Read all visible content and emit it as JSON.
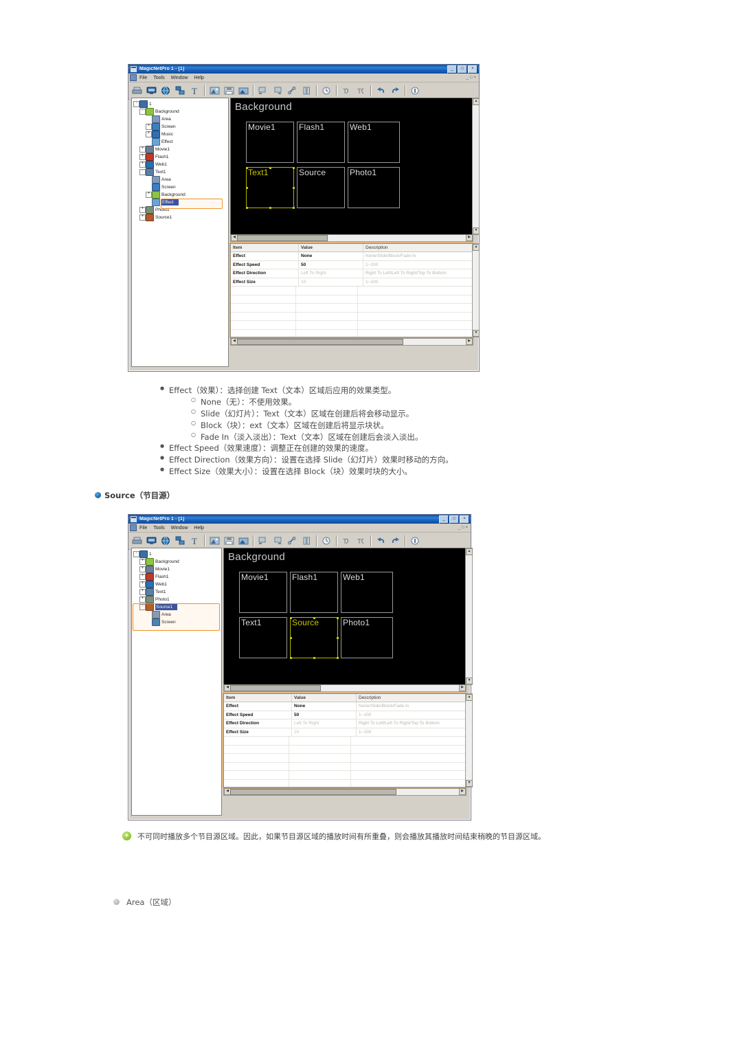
{
  "window": {
    "title": "MagicNetPro 1 - [1]",
    "menu": [
      "File",
      "Tools",
      "Window",
      "Help"
    ],
    "controls": [
      "_",
      "□",
      "×"
    ],
    "mdi_controls": [
      "_",
      "□",
      "×"
    ],
    "toolbar_icons": [
      "print-icon",
      "monitor-icon",
      "globe-icon",
      "network-icon",
      "text-tool-icon",
      "image-icon",
      "save-icon",
      "photo-icon",
      "align-left-icon",
      "align-right-icon",
      "link-icon",
      "column-icon",
      "clock-icon",
      "effect-in-icon",
      "effect-out-icon",
      "undo-icon",
      "redo-icon",
      "info-icon"
    ]
  },
  "figure1": {
    "tree": [
      {
        "label": "1",
        "depth": 0,
        "icon": "root-icon",
        "expander": "-",
        "selected": false
      },
      {
        "label": "Background",
        "depth": 1,
        "icon": "background-icon",
        "expander": "-",
        "selected": false
      },
      {
        "label": "Area",
        "depth": 2,
        "icon": "area-icon",
        "expander": "",
        "selected": false
      },
      {
        "label": "Screen",
        "depth": 2,
        "icon": "screen-icon",
        "expander": "+",
        "selected": false
      },
      {
        "label": "Music",
        "depth": 2,
        "icon": "music-icon",
        "expander": "+",
        "selected": false
      },
      {
        "label": "Effect",
        "depth": 2,
        "icon": "effect-icon",
        "expander": "",
        "selected": false
      },
      {
        "label": "Movie1",
        "depth": 1,
        "icon": "movie-icon",
        "expander": "+",
        "selected": false
      },
      {
        "label": "Flash1",
        "depth": 1,
        "icon": "flash-icon",
        "expander": "+",
        "selected": false
      },
      {
        "label": "Web1",
        "depth": 1,
        "icon": "web-icon",
        "expander": "+",
        "selected": false
      },
      {
        "label": "Text1",
        "depth": 1,
        "icon": "text-icon",
        "expander": "-",
        "selected": false
      },
      {
        "label": "Area",
        "depth": 2,
        "icon": "area-icon",
        "expander": "",
        "selected": false
      },
      {
        "label": "Screen",
        "depth": 2,
        "icon": "screen-icon",
        "expander": "",
        "selected": false
      },
      {
        "label": "Background",
        "depth": 2,
        "icon": "background-icon",
        "expander": "+",
        "selected": false
      },
      {
        "label": "Effect",
        "depth": 2,
        "icon": "effect-icon",
        "expander": "",
        "selected": true
      },
      {
        "label": "Photo1",
        "depth": 1,
        "icon": "photo-icon",
        "expander": "+",
        "selected": false
      },
      {
        "label": "Source1",
        "depth": 1,
        "icon": "source-icon",
        "expander": "+",
        "selected": false
      }
    ],
    "canvas": {
      "title": "Background",
      "boxes": [
        {
          "label": "Movie1",
          "selected": false
        },
        {
          "label": "Flash1",
          "selected": false
        },
        {
          "label": "Web1",
          "selected": false
        },
        {
          "label": "Text1",
          "selected": true
        },
        {
          "label": "Source",
          "selected": false
        },
        {
          "label": "Photo1",
          "selected": false
        }
      ]
    },
    "props": {
      "headers": [
        "Item",
        "Value",
        "Description"
      ],
      "rows": [
        {
          "item": "Effect",
          "value": "None",
          "desc": "None/Slide/Block/Fade In",
          "dim": false
        },
        {
          "item": "Effect Speed",
          "value": "50",
          "desc": "1~100",
          "dim": false
        },
        {
          "item": "Effect Direction",
          "value": "Left To Right",
          "desc": "Right To Left/Left To Right/Top To Bottom",
          "dim": true
        },
        {
          "item": "Effect Size",
          "value": "10",
          "desc": "1~100",
          "dim": true
        }
      ]
    }
  },
  "effect_list": {
    "b1": "Effect（效果）：选择创建 Text（文本）区域后应用的效果类型。",
    "s1": "None（无）：不使用效果。",
    "s2": "Slide（幻灯片）：Text（文本）区域在创建后将会移动显示。",
    "s3": "Block（块）：ext（文本）区域在创建后将显示块状。",
    "s4": "Fade In（淡入淡出）：Text（文本）区域在创建后会淡入淡出。",
    "b2": "Effect Speed（效果速度）：调整正在创建的效果的速度。",
    "b3": "Effect Direction（效果方向）：设置在选择 Slide（幻灯片）效果时移动的方向。",
    "b4": "Effect Size（效果大小）：设置在选择 Block（块）效果时块的大小。"
  },
  "source_section": {
    "heading": "Source（节目源）"
  },
  "figure2": {
    "tree": [
      {
        "label": "1",
        "depth": 0,
        "icon": "root-icon",
        "expander": "-",
        "selected": false
      },
      {
        "label": "Background",
        "depth": 1,
        "icon": "background-icon",
        "expander": "+",
        "selected": false
      },
      {
        "label": "Movie1",
        "depth": 1,
        "icon": "movie-icon",
        "expander": "+",
        "selected": false
      },
      {
        "label": "Flash1",
        "depth": 1,
        "icon": "flash-icon",
        "expander": "+",
        "selected": false
      },
      {
        "label": "Web1",
        "depth": 1,
        "icon": "web-icon",
        "expander": "+",
        "selected": false
      },
      {
        "label": "Text1",
        "depth": 1,
        "icon": "text-icon",
        "expander": "+",
        "selected": false
      },
      {
        "label": "Photo1",
        "depth": 1,
        "icon": "photo-icon",
        "expander": "+",
        "selected": false
      },
      {
        "label": "Source1",
        "depth": 1,
        "icon": "source-icon",
        "expander": "-",
        "selected": true
      },
      {
        "label": "Area",
        "depth": 2,
        "icon": "area-icon",
        "expander": "",
        "selected": false
      },
      {
        "label": "Screen",
        "depth": 2,
        "icon": "screen-icon",
        "expander": "",
        "selected": false
      }
    ],
    "canvas": {
      "title": "Background",
      "boxes": [
        {
          "label": "Movie1",
          "selected": false
        },
        {
          "label": "Flash1",
          "selected": false
        },
        {
          "label": "Web1",
          "selected": false
        },
        {
          "label": "Text1",
          "selected": false
        },
        {
          "label": "Source",
          "selected": true
        },
        {
          "label": "Photo1",
          "selected": false
        }
      ]
    },
    "props": {
      "headers": [
        "Item",
        "Value",
        "Description"
      ],
      "rows": [
        {
          "item": "Effect",
          "value": "None",
          "desc": "None/Slide/Block/Fade In",
          "dim": false
        },
        {
          "item": "Effect Speed",
          "value": "50",
          "desc": "1~100",
          "dim": false
        },
        {
          "item": "Effect Direction",
          "value": "Left To Right",
          "desc": "Right To Left/Left To Right/Top To Bottom",
          "dim": true
        },
        {
          "item": "Effect Size",
          "value": "10",
          "desc": "1~100",
          "dim": true
        }
      ]
    }
  },
  "note": {
    "icon": "+",
    "text": "不可同时播放多个节目源区域。因此，如果节目源区域的播放时间有所重叠，则会播放其播放时间结束稍晚的节目源区域。"
  },
  "area_section": {
    "heading": "Area（区域）"
  },
  "colors": {
    "highlight_orange": "#f0932b",
    "selection_blue": "#2b4ea8",
    "selected_region_yellow": "#c9c800",
    "title_gradient_start": "#0a4fa5"
  }
}
